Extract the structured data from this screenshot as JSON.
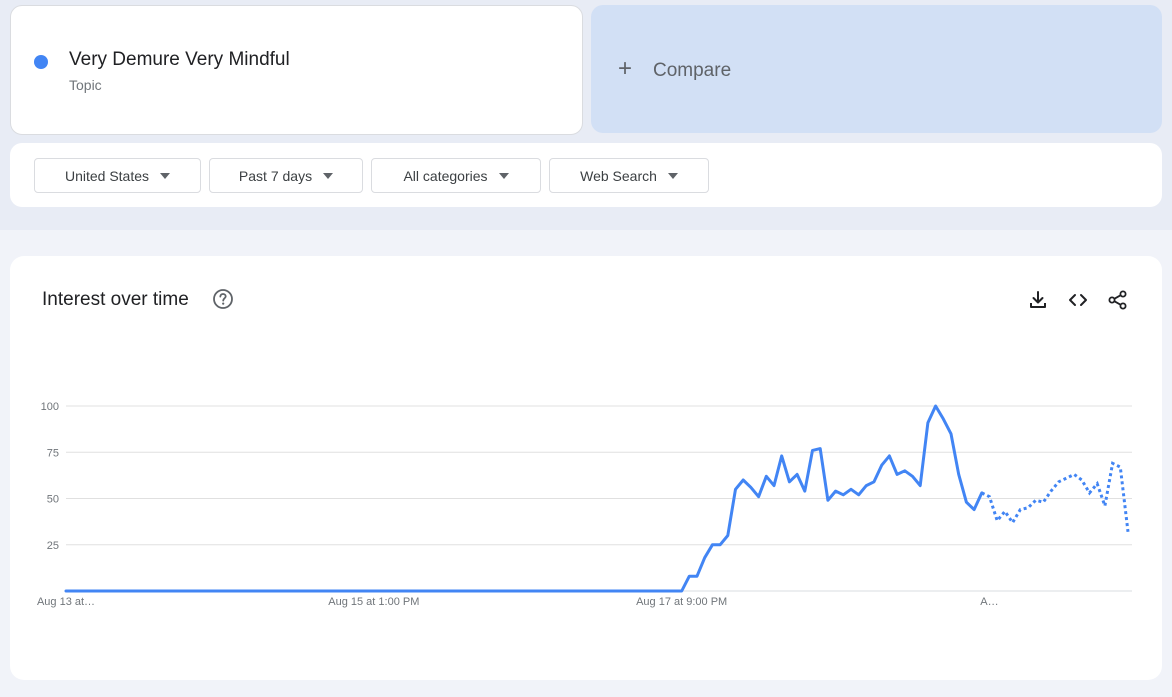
{
  "search_term": {
    "name": "Very Demure Very Mindful",
    "type": "Topic",
    "dot_color": "#4285f4"
  },
  "compare": {
    "plus": "+",
    "label": "Compare"
  },
  "filters": [
    {
      "label": "United States"
    },
    {
      "label": "Past 7 days"
    },
    {
      "label": "All categories"
    },
    {
      "label": "Web Search"
    }
  ],
  "chart": {
    "title": "Interest over time",
    "actions": [
      "download-icon",
      "embed-icon",
      "share-icon"
    ]
  },
  "chart_data": {
    "type": "line",
    "title": "Interest over time",
    "xlabel": "",
    "ylabel": "",
    "ylim": [
      0,
      100
    ],
    "y_ticks": [
      25,
      50,
      75,
      100
    ],
    "grid": true,
    "x_tick_labels": [
      "Aug 13 at…",
      "Aug 15 at 1:00 PM",
      "Aug 17 at 9:00 PM",
      "A…"
    ],
    "x_tick_index": [
      0,
      40,
      80,
      120
    ],
    "color": "#4285f4",
    "partial_from_index": 119,
    "series": [
      {
        "values": [
          0,
          0,
          0,
          0,
          0,
          0,
          0,
          0,
          0,
          0,
          0,
          0,
          0,
          0,
          0,
          0,
          0,
          0,
          0,
          0,
          0,
          0,
          0,
          0,
          0,
          0,
          0,
          0,
          0,
          0,
          0,
          0,
          0,
          0,
          0,
          0,
          0,
          0,
          0,
          0,
          0,
          0,
          0,
          0,
          0,
          0,
          0,
          0,
          0,
          0,
          0,
          0,
          0,
          0,
          0,
          0,
          0,
          0,
          0,
          0,
          0,
          0,
          0,
          0,
          0,
          0,
          0,
          0,
          0,
          0,
          0,
          0,
          0,
          0,
          0,
          0,
          0,
          0,
          0,
          0,
          0,
          8,
          8,
          18,
          25,
          25,
          30,
          55,
          60,
          56,
          51,
          62,
          57,
          73,
          59,
          63,
          54,
          76,
          77,
          49,
          54,
          52,
          55,
          52,
          57,
          59,
          68,
          73,
          63,
          65,
          62,
          57,
          91,
          100,
          93,
          85,
          63,
          48,
          44,
          53,
          51,
          38,
          43,
          37,
          44,
          45,
          49,
          48,
          54,
          59,
          61,
          63,
          60,
          53,
          58,
          46,
          69,
          67,
          32
        ]
      }
    ]
  }
}
